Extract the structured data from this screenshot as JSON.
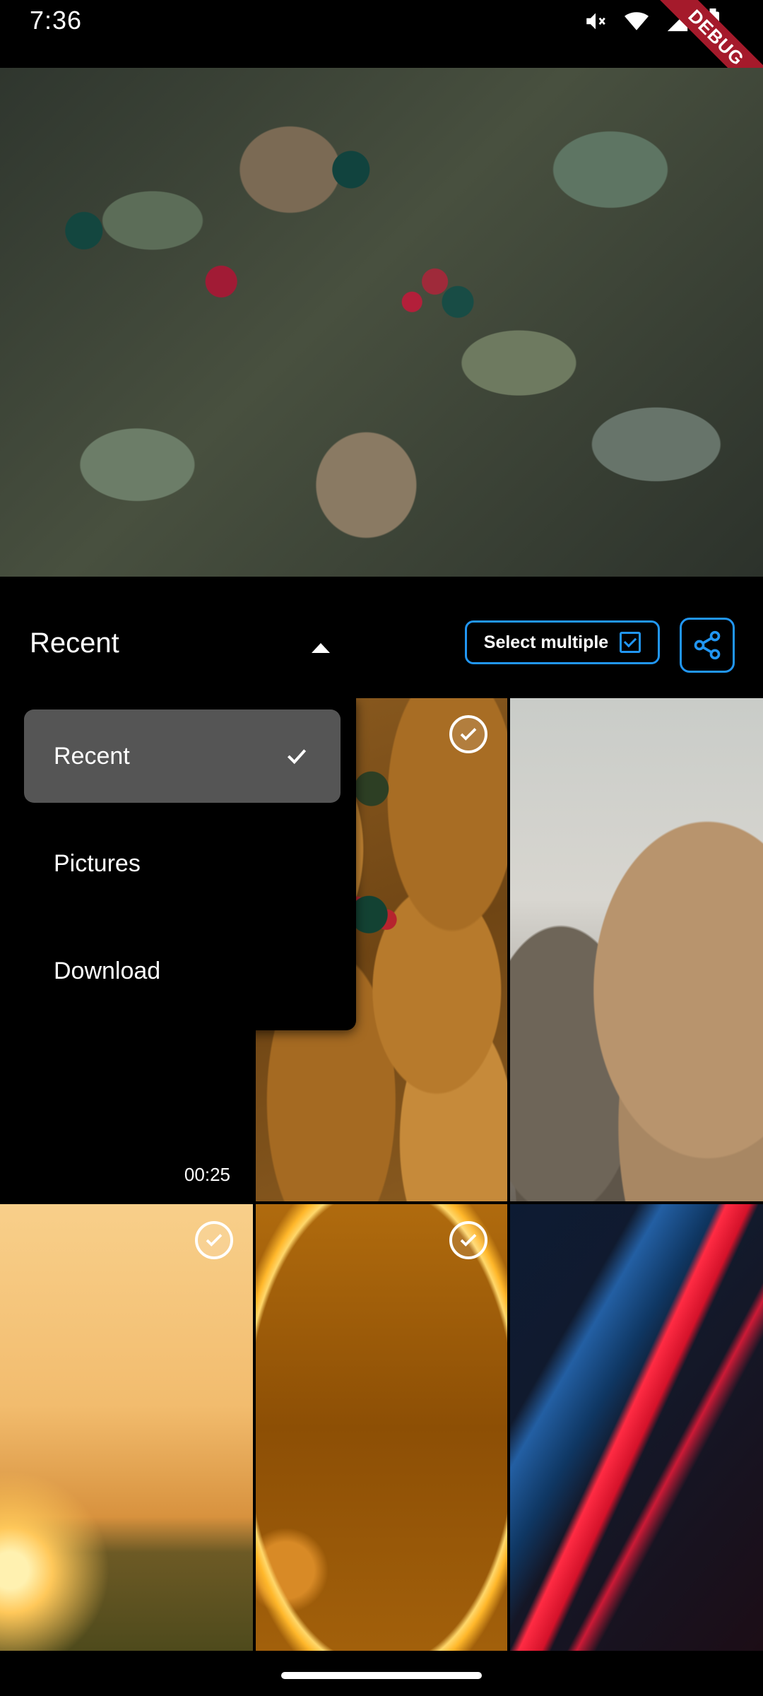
{
  "status_bar": {
    "time": "7:36",
    "debug_label": "DEBUG",
    "icons": [
      "mute-icon",
      "wifi-icon",
      "signal-icon",
      "battery-icon"
    ]
  },
  "toolbar": {
    "album_label": "Recent",
    "select_multiple_label": "Select multiple",
    "share_icon": "share-icon",
    "accent_color": "#2196f3"
  },
  "album_menu": {
    "items": [
      {
        "label": "Recent",
        "selected": true
      },
      {
        "label": "Pictures",
        "selected": false
      },
      {
        "label": "Download",
        "selected": false
      }
    ]
  },
  "grid": {
    "tiles": [
      {
        "kind": "video",
        "duration": "00:25",
        "selected": false
      },
      {
        "kind": "image",
        "subject": "berries",
        "selected": true
      },
      {
        "kind": "image",
        "subject": "cliff",
        "selected": false
      },
      {
        "kind": "image",
        "subject": "sunset-field",
        "selected": true
      },
      {
        "kind": "image",
        "subject": "golden-ring",
        "selected": true
      },
      {
        "kind": "image",
        "subject": "abstract-red-blue",
        "selected": false
      }
    ]
  }
}
